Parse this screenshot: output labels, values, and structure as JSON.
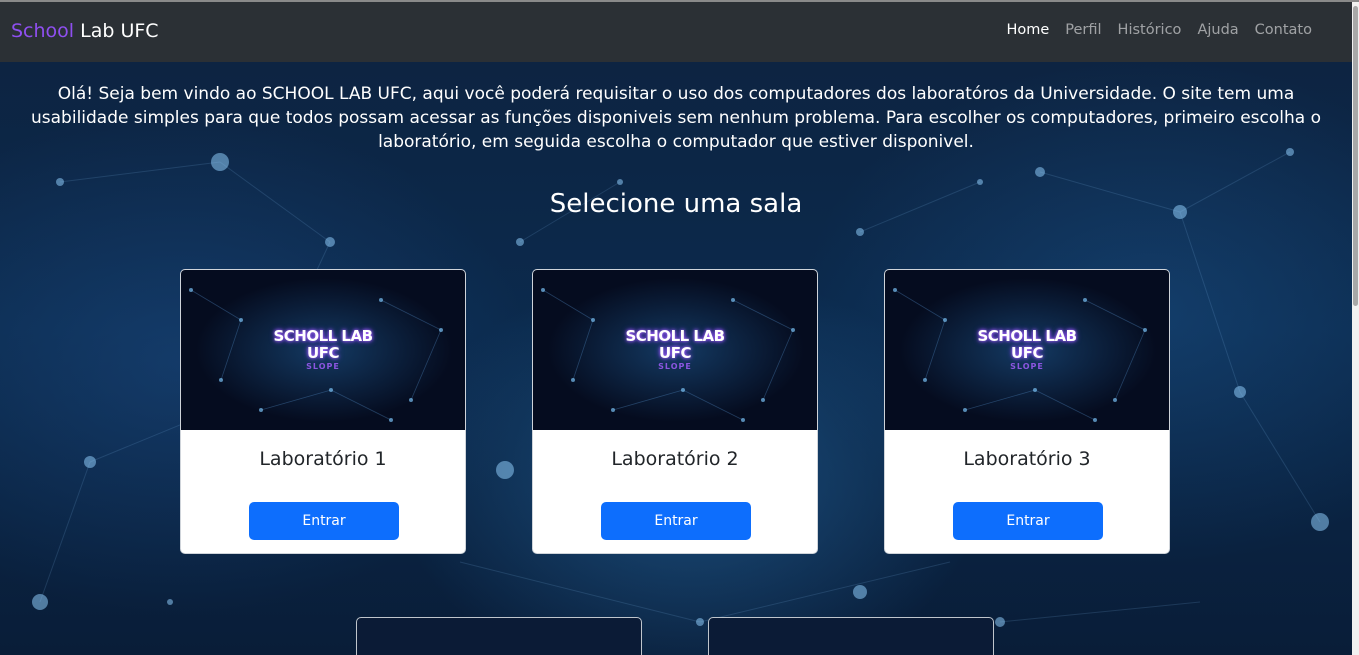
{
  "brand": {
    "accent": "School",
    "rest": " Lab UFC"
  },
  "nav": {
    "home": "Home",
    "perfil": "Perfil",
    "historico": "Histórico",
    "ajuda": "Ajuda",
    "contato": "Contato"
  },
  "intro": "Olá! Seja bem vindo ao SCHOOL LAB UFC, aqui você poderá requisitar o uso dos computadores dos laboratóros da Universidade. O site tem uma usabilidade simples para que todos possam acessar as funções disponiveis sem nenhum problema. Para escolher os computadores, primeiro escolha o laboratório, em seguida escolha o computador que estiver disponivel.",
  "section_title": "Selecione uma sala",
  "card_logo": {
    "line1": "SCHOLL LAB",
    "line2": "UFC",
    "line3": "SLOPE"
  },
  "labs": [
    {
      "title": "Laboratório 1",
      "button": "Entrar"
    },
    {
      "title": "Laboratório 2",
      "button": "Entrar"
    },
    {
      "title": "Laboratório 3",
      "button": "Entrar"
    }
  ],
  "colors": {
    "navbar": "#2b3035",
    "brand_accent": "#8f4ff0",
    "button": "#0d6efd"
  },
  "icons": {
    "card_image": "network-constellation-image"
  }
}
